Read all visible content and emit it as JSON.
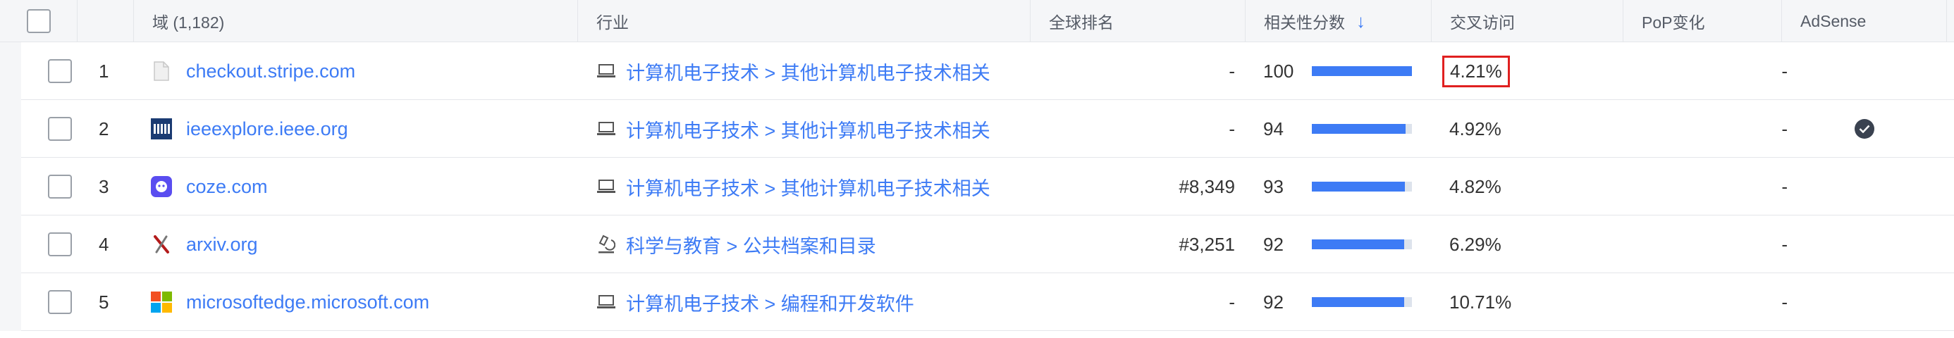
{
  "header": {
    "domain_label": "域 (1,182)",
    "industry_label": "行业",
    "global_rank_label": "全球排名",
    "relevance_label": "相关性分数",
    "cross_visit_label": "交叉访问",
    "pop_label": "PoP变化",
    "adsense_label": "AdSense"
  },
  "colors": {
    "link": "#3d7bf5",
    "bar": "#3d7bf5",
    "highlight": "#e02020"
  },
  "rows": [
    {
      "rank": "1",
      "domain": "checkout.stripe.com",
      "favicon": "blank-page-icon",
      "industry_icon": "laptop-icon",
      "industry": "计算机电子技术 > 其他计算机电子技术相关",
      "global_rank": "-",
      "relevance": "100",
      "relevance_fraction": 1.0,
      "cross_visit": "4.21%",
      "pop": "-",
      "adsense": false
    },
    {
      "rank": "2",
      "domain": "ieeexplore.ieee.org",
      "favicon": "ieee-logo-icon",
      "industry_icon": "laptop-icon",
      "industry": "计算机电子技术 > 其他计算机电子技术相关",
      "global_rank": "-",
      "relevance": "94",
      "relevance_fraction": 0.94,
      "cross_visit": "4.92%",
      "pop": "-",
      "adsense": true
    },
    {
      "rank": "3",
      "domain": "coze.com",
      "favicon": "coze-logo-icon",
      "industry_icon": "laptop-icon",
      "industry": "计算机电子技术 > 其他计算机电子技术相关",
      "global_rank": "#8,349",
      "relevance": "93",
      "relevance_fraction": 0.93,
      "cross_visit": "4.82%",
      "pop": "-",
      "adsense": false
    },
    {
      "rank": "4",
      "domain": "arxiv.org",
      "favicon": "arxiv-logo-icon",
      "industry_icon": "microscope-icon",
      "industry": "科学与教育 > 公共档案和目录",
      "global_rank": "#3,251",
      "relevance": "92",
      "relevance_fraction": 0.92,
      "cross_visit": "6.29%",
      "pop": "-",
      "adsense": false
    },
    {
      "rank": "5",
      "domain": "microsoftedge.microsoft.com",
      "favicon": "microsoft-logo-icon",
      "industry_icon": "laptop-icon",
      "industry": "计算机电子技术 > 编程和开发软件",
      "global_rank": "-",
      "relevance": "92",
      "relevance_fraction": 0.92,
      "cross_visit": "10.71%",
      "pop": "-",
      "adsense": false
    }
  ]
}
